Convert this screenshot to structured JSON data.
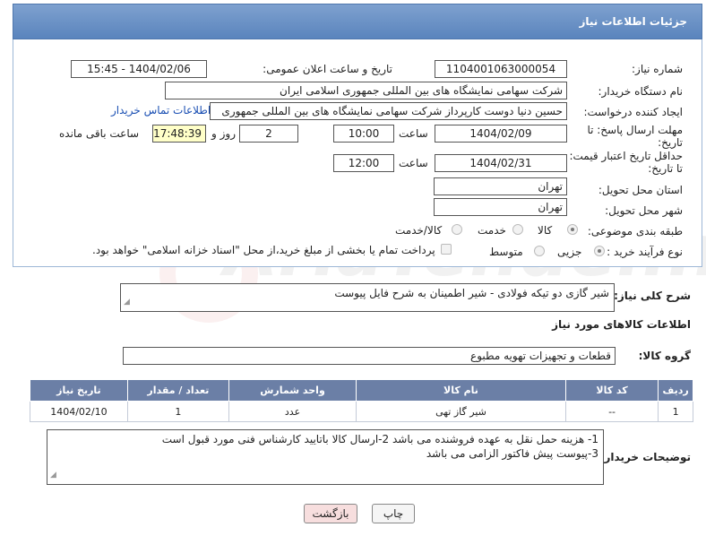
{
  "header": {
    "title": "جزئیات اطلاعات نیاز"
  },
  "fields": {
    "need_number": {
      "label": "شماره نیاز:",
      "value": "1104001063000054"
    },
    "announce_date": {
      "label": "تاریخ و ساعت اعلان عمومی:",
      "value": "1404/02/06 - 15:45"
    },
    "buyer_org": {
      "label": "نام دستگاه خریدار:",
      "value": "شرکت سهامی نمایشگاه های بین المللی جمهوری اسلامی ایران"
    },
    "requester": {
      "label": "ایجاد کننده درخواست:",
      "value": "حسین دنیا دوست کارپرداز شرکت سهامی نمایشگاه های بین المللی جمهوری",
      "contact_link": "اطلاعات تماس خریدار"
    },
    "reply_deadline": {
      "label_line1": "مهلت ارسال پاسخ: تا",
      "label_line2": "تاریخ:",
      "date": "1404/02/09",
      "time_label": "ساعت",
      "time": "10:00",
      "days": "2",
      "days_label": "روز و",
      "remaining": "17:48:39",
      "remaining_label": "ساعت باقی مانده"
    },
    "price_validity": {
      "label_line1": "حداقل تاریخ اعتبار قیمت:",
      "label_line2": "تا تاریخ:",
      "date": "1404/02/31",
      "time_label": "ساعت",
      "time": "12:00"
    },
    "delivery_province": {
      "label": "استان محل تحویل:",
      "value": "تهران"
    },
    "delivery_city": {
      "label": "شهر محل تحویل:",
      "value": "تهران"
    },
    "category": {
      "label": "طبقه بندی موضوعی:",
      "options": [
        "کالا",
        "خدمت",
        "کالا/خدمت"
      ]
    },
    "process": {
      "label": "نوع فرآیند خرید :",
      "options": [
        "جزیی",
        "متوسط"
      ],
      "note": "پرداخت تمام یا بخشی از مبلغ خرید،از محل \"اسناد خزانه اسلامی\" خواهد بود."
    }
  },
  "general_desc": {
    "label": "شرح کلی نیاز:",
    "value": "شیر گازی دو تیکه فولادی - شیر اطمینان  به شرح فایل پیوست"
  },
  "goods_section": {
    "title": "اطلاعات کالاهای مورد نیاز"
  },
  "goods_group": {
    "label": "گروه کالا:",
    "value": "قطعات و تجهیزات تهویه مطبوع"
  },
  "table": {
    "headers": [
      "ردیف",
      "کد کالا",
      "نام کالا",
      "واحد شمارش",
      "تعداد / مقدار",
      "تاریخ نیاز"
    ],
    "rows": [
      [
        "1",
        "--",
        "شیر گاز تهی",
        "عدد",
        "1",
        "1404/02/10"
      ]
    ]
  },
  "buyer_notes": {
    "label": "توضیحات خریدار:",
    "line1": "1- هزینه حمل نقل به عهده فروشنده می باشد 2-ارسال کالا باتایید کارشناس فنی مورد قبول است",
    "line2": "3-پیوست پیش فاکتور الزامی می باشد"
  },
  "buttons": {
    "print": "چاپ",
    "back": "بازگشت"
  },
  "watermark": "AriaTender.net"
}
